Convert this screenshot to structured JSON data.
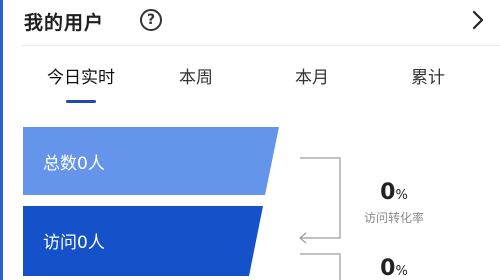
{
  "header": {
    "title": "我的用户",
    "help_icon": "question-circle-icon",
    "more_icon": "chevron-right-icon"
  },
  "tabs": [
    {
      "label": "今日实时",
      "active": true
    },
    {
      "label": "本周",
      "active": false
    },
    {
      "label": "本月",
      "active": false
    },
    {
      "label": "累计",
      "active": false
    }
  ],
  "funnel": {
    "total_label": "总数0人",
    "visit_label": "访问0人",
    "colors": {
      "total": "#6495ea",
      "visit": "#1552c9"
    }
  },
  "rates": [
    {
      "value": "0",
      "unit": "%",
      "label": "访问转化率"
    },
    {
      "value": "0",
      "unit": "%",
      "label": ""
    }
  ],
  "colors": {
    "accent": "#1f47b8",
    "edge": "#2f5fd0"
  }
}
